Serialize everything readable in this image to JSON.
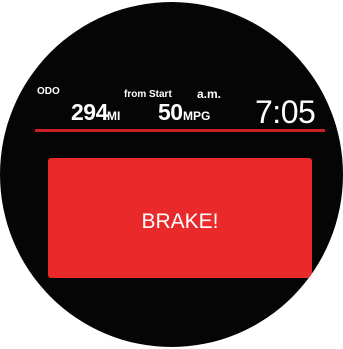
{
  "status_bar": {
    "odo_label": "ODO",
    "odo_value": "294",
    "odo_unit": "MI",
    "from_start_label": "from Start",
    "mpg_value": "50",
    "mpg_unit": "MPG",
    "am_pm": "a.m.",
    "clock": "7:05"
  },
  "alert": {
    "message": "BRAKE!"
  },
  "colors": {
    "display_background": "#050505",
    "alert_background": "#ea2a2a",
    "divider": "#c81f24",
    "text": "#ffffff"
  }
}
